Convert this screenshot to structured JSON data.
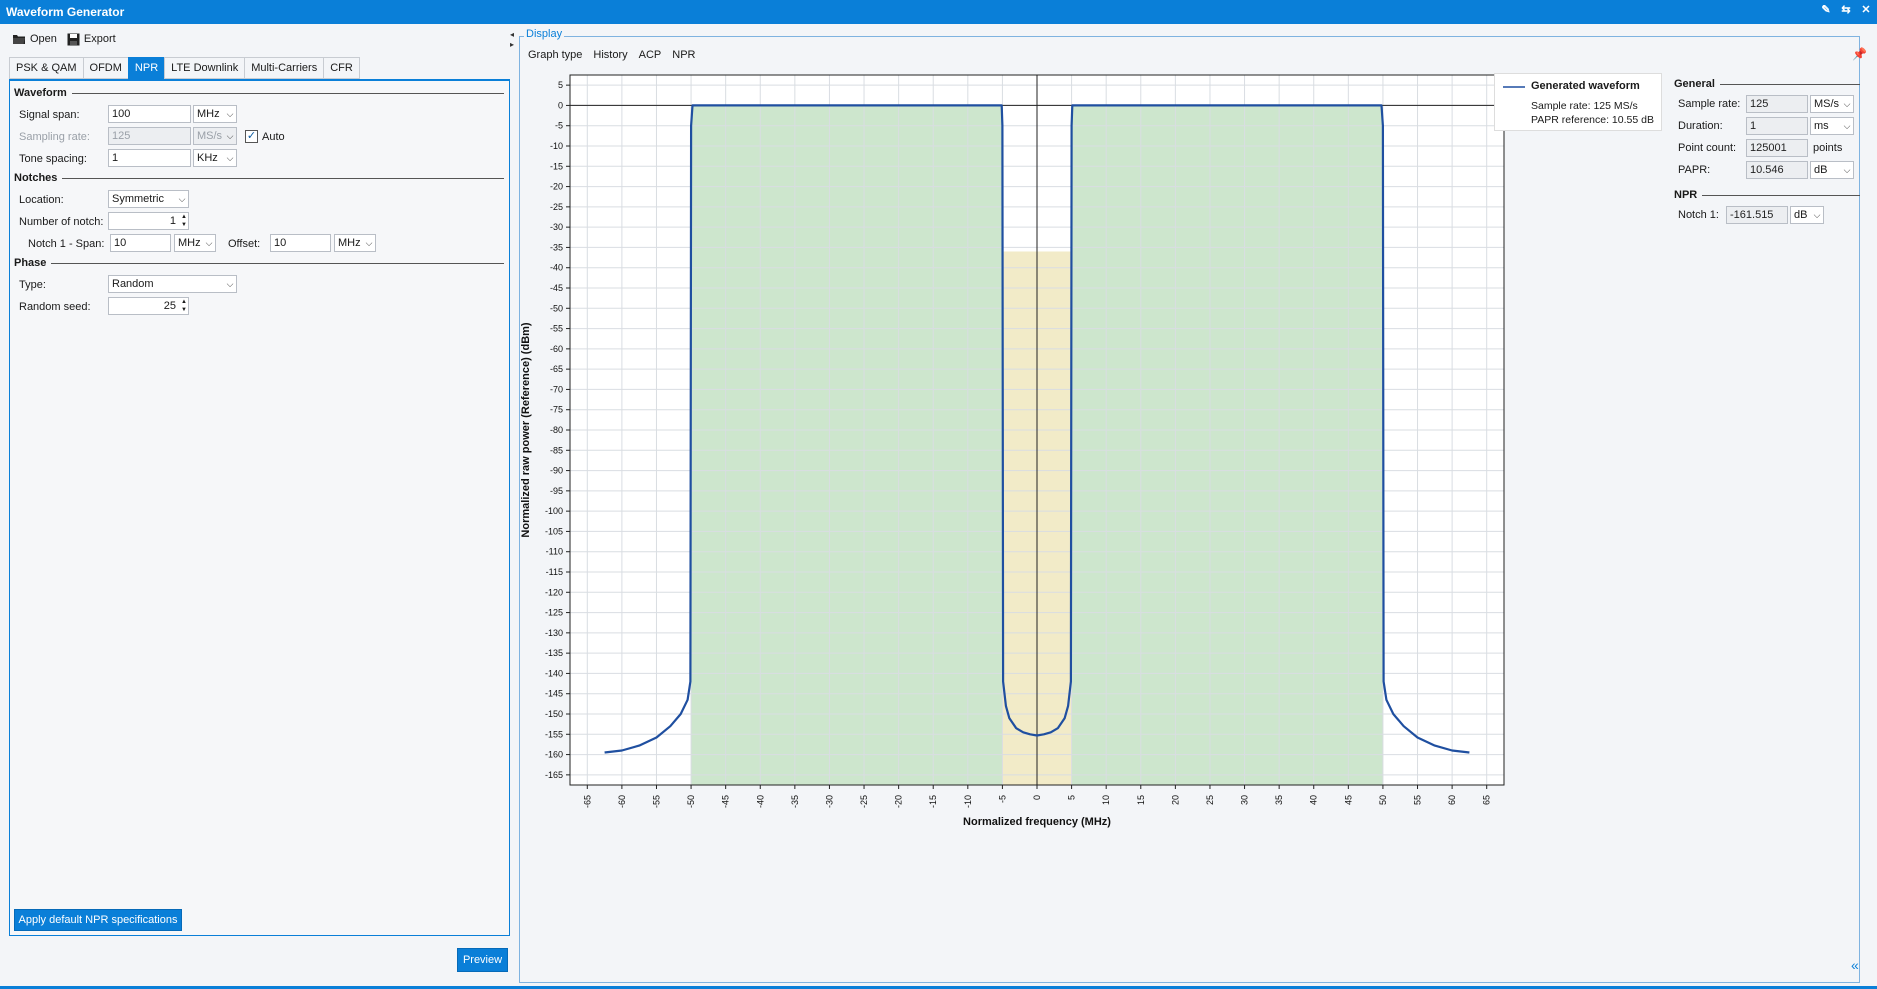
{
  "window": {
    "title": "Waveform Generator",
    "controls": [
      "✎",
      "⇆",
      "✕"
    ]
  },
  "toolbar": {
    "open_label": "Open",
    "export_label": "Export"
  },
  "tabs": [
    "PSK & QAM",
    "OFDM",
    "NPR",
    "LTE Downlink",
    "Multi-Carriers",
    "CFR"
  ],
  "active_tab": "NPR",
  "waveform": {
    "section": "Waveform",
    "signal_span_label": "Signal span:",
    "signal_span_value": "100",
    "signal_span_unit": "MHz",
    "sampling_rate_label": "Sampling rate:",
    "sampling_rate_value": "125",
    "sampling_rate_unit": "MS/s",
    "auto_label": "Auto",
    "auto_checked": true,
    "tone_spacing_label": "Tone spacing:",
    "tone_spacing_value": "1",
    "tone_spacing_unit": "KHz"
  },
  "notches": {
    "section": "Notches",
    "location_label": "Location:",
    "location_value": "Symmetric",
    "number_label": "Number of notch:",
    "number_value": "1",
    "notch1_span_label": "Notch 1 - Span:",
    "notch1_span_value": "10",
    "notch1_span_unit": "MHz",
    "offset_label": "Offset:",
    "offset_value": "10",
    "offset_unit": "MHz"
  },
  "phase": {
    "section": "Phase",
    "type_label": "Type:",
    "type_value": "Random",
    "seed_label": "Random seed:",
    "seed_value": "25"
  },
  "buttons": {
    "apply_label": "Apply default NPR specifications",
    "preview_label": "Preview"
  },
  "display": {
    "title": "Display",
    "menu": [
      "Graph type",
      "History",
      "ACP",
      "NPR"
    ]
  },
  "legend": {
    "series_name": "Generated waveform",
    "sample_rate": "Sample rate: 125 MS/s",
    "papr_ref": "PAPR reference: 10.55 dB"
  },
  "general": {
    "section": "General",
    "sample_rate_label": "Sample rate:",
    "sample_rate_value": "125",
    "sample_rate_unit": "MS/s",
    "duration_label": "Duration:",
    "duration_value": "1",
    "duration_unit": "ms",
    "point_count_label": "Point count:",
    "point_count_value": "125001",
    "point_count_unit": "points",
    "papr_label": "PAPR:",
    "papr_value": "10.546",
    "papr_unit": "dB"
  },
  "npr": {
    "section": "NPR",
    "notch1_label": "Notch 1:",
    "notch1_value": "-161.515",
    "notch1_unit": "dB"
  },
  "colors": {
    "accent": "#0a7fd8",
    "band_fill": "#cde6cd",
    "notch_fill": "#f2ebc8",
    "trace": "#1f4fa0"
  },
  "chart_data": {
    "type": "line",
    "xlabel": "Normalized frequency (MHz)",
    "ylabel": "Normalized raw power (Reference) (dBm)",
    "xlim": [
      -67.5,
      67.5
    ],
    "ylim": [
      -167.5,
      7.5
    ],
    "xticks": [
      -65,
      -60,
      -55,
      -50,
      -45,
      -40,
      -35,
      -30,
      -25,
      -20,
      -15,
      -10,
      -5,
      0,
      5,
      10,
      15,
      20,
      25,
      30,
      35,
      40,
      45,
      50,
      55,
      60,
      65
    ],
    "yticks": [
      5,
      0,
      -5,
      -10,
      -15,
      -20,
      -25,
      -30,
      -35,
      -40,
      -45,
      -50,
      -55,
      -60,
      -65,
      -70,
      -75,
      -80,
      -85,
      -90,
      -95,
      -100,
      -105,
      -110,
      -115,
      -120,
      -125,
      -130,
      -135,
      -140,
      -145,
      -150,
      -155,
      -160,
      -165
    ],
    "grid": true,
    "bands": [
      {
        "from": -50,
        "to": -5,
        "top": 0,
        "kind": "signal"
      },
      {
        "from": 5,
        "to": 50,
        "top": 0,
        "kind": "signal"
      },
      {
        "from": -5,
        "to": 5,
        "top": -36,
        "kind": "notch"
      }
    ],
    "series": [
      {
        "name": "Generated waveform",
        "x": [
          -62.5,
          -60,
          -57.5,
          -55,
          -53,
          -51.5,
          -50.5,
          -50.1,
          -50,
          -49.8,
          -45,
          -30,
          -15,
          -6,
          -5.1,
          -5,
          -4.9,
          -4.5,
          -4,
          -3,
          -2,
          -1,
          0,
          1,
          2,
          3,
          4,
          4.5,
          4.9,
          5,
          5.1,
          6,
          15,
          30,
          45,
          49.8,
          50,
          50.1,
          50.5,
          51.5,
          53,
          55,
          57.5,
          60,
          62.5
        ],
        "y": [
          -159.5,
          -159,
          -157.8,
          -155.8,
          -153,
          -150,
          -146.5,
          -142,
          -5,
          0,
          0,
          0,
          0,
          0,
          0,
          -5,
          -142,
          -148,
          -151,
          -153.5,
          -154.5,
          -155,
          -155.3,
          -155,
          -154.5,
          -153.5,
          -151,
          -148,
          -142,
          -5,
          0,
          0,
          0,
          0,
          0,
          0,
          -5,
          -142,
          -146.5,
          -150,
          -153,
          -155.8,
          -157.8,
          -159,
          -159.5
        ]
      }
    ]
  }
}
